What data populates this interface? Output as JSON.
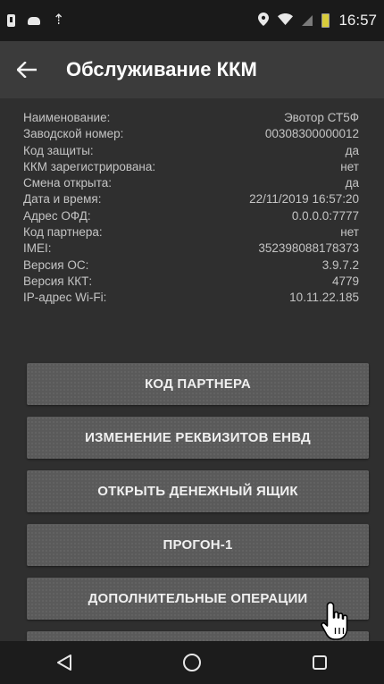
{
  "status_bar": {
    "time": "16:57",
    "left_icons": [
      "sim-card-icon",
      "cloud-icon",
      "upload-icon"
    ],
    "right_icons": [
      "location-icon",
      "wifi-icon",
      "signal-icon",
      "battery-icon"
    ],
    "battery_color": "#d8cc3a"
  },
  "app_bar": {
    "title": "Обслуживание ККМ",
    "back_icon": "arrow-left-icon"
  },
  "info_rows": [
    {
      "label": "Наименование:",
      "value": "Эвотор СТ5Ф"
    },
    {
      "label": "Заводской номер:",
      "value": "00308300000012"
    },
    {
      "label": "Код защиты:",
      "value": "да"
    },
    {
      "label": "ККМ зарегистрирована:",
      "value": "нет"
    },
    {
      "label": "Смена открыта:",
      "value": "да"
    },
    {
      "label": "Дата и время:",
      "value": "22/11/2019 16:57:20"
    },
    {
      "label": "Адрес ОФД:",
      "value": "0.0.0.0:7777"
    },
    {
      "label": "Код партнера:",
      "value": "нет"
    },
    {
      "label": "IMEI:",
      "value": "352398088178373"
    },
    {
      "label": "Версия ОС:",
      "value": "3.9.7.2"
    },
    {
      "label": "Версия ККТ:",
      "value": "4779"
    },
    {
      "label": "IP-адрес Wi-Fi:",
      "value": "10.11.22.185"
    }
  ],
  "buttons": [
    {
      "label": "КОД ПАРТНЕРА"
    },
    {
      "label": "ИЗМЕНЕНИЕ РЕКВИЗИТОВ ЕНВД"
    },
    {
      "label": "ОТКРЫТЬ ДЕНЕЖНЫЙ ЯЩИК"
    },
    {
      "label": "ПРОГОН-1"
    },
    {
      "label": "ДОПОЛНИТЕЛЬНЫЕ ОПЕРАЦИИ"
    }
  ],
  "nav_bar": {
    "icons": [
      "back-triangle-icon",
      "home-circle-icon",
      "recents-square-icon"
    ]
  },
  "colors": {
    "background": "#2f2f2f",
    "app_bar": "#3b3b3b",
    "button": "#5a5a5a",
    "text": "#c8c8c8"
  }
}
